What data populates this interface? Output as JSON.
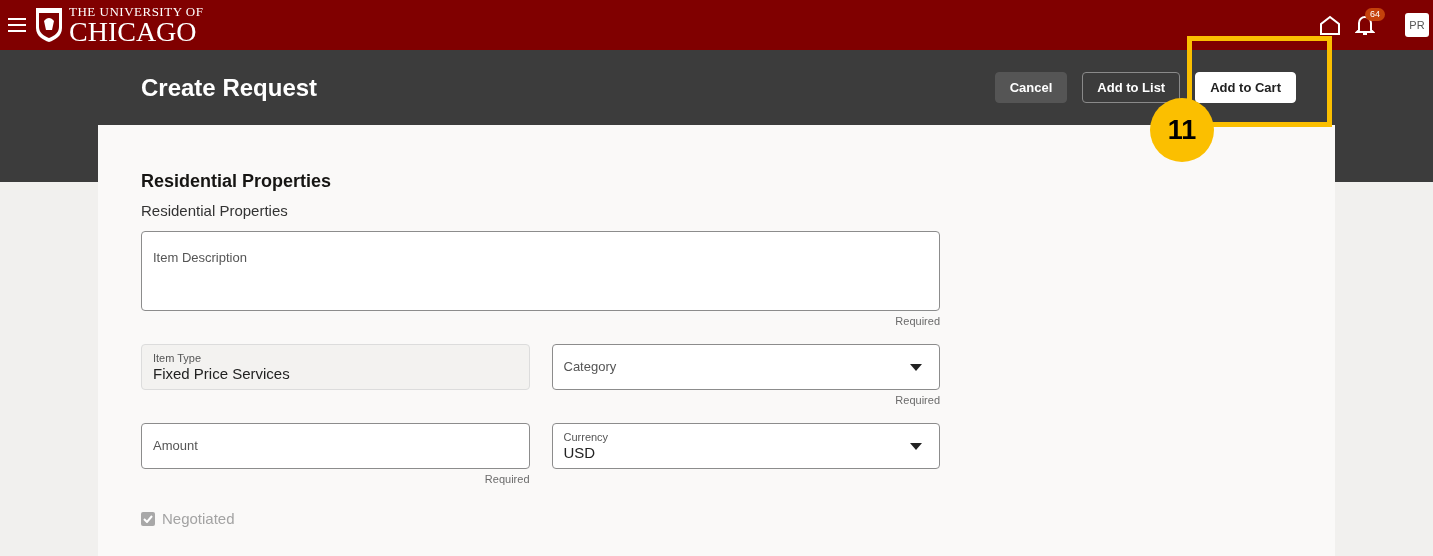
{
  "header": {
    "logo_line_1": "THE UNIVERSITY OF",
    "logo_line_2": "CHICAGO",
    "notification_count": "64",
    "avatar": "PR"
  },
  "page": {
    "title": "Create Request",
    "buttons": [
      {
        "label": "Cancel",
        "kind": "secondary"
      },
      {
        "label": "Add to List",
        "kind": "outline"
      },
      {
        "label": "Add to Cart",
        "kind": "primary"
      }
    ]
  },
  "callout": {
    "number": "11"
  },
  "form": {
    "heading": "Residential Properties",
    "subtitle": "Residential Properties",
    "rows": [
      [
        {
          "kind": "textarea",
          "label": "Item Description",
          "hint": "Required"
        }
      ],
      [
        {
          "kind": "readonly",
          "label": "Item Type",
          "value": "Fixed Price Services"
        },
        {
          "kind": "select",
          "label": "Category",
          "hint": "Required"
        }
      ],
      [
        {
          "kind": "text",
          "label": "Amount",
          "hint": "Required"
        },
        {
          "kind": "select",
          "label": "Currency",
          "value": "USD"
        }
      ]
    ],
    "checkbox": {
      "label": "Negotiated",
      "checked": true,
      "disabled": true
    }
  }
}
